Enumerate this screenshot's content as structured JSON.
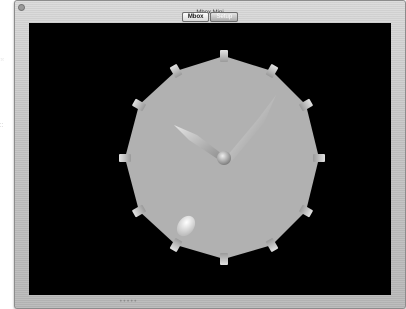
{
  "window": {
    "title": "Mbox Mini"
  },
  "tabs": [
    {
      "label": "Mbox",
      "active": true
    },
    {
      "label": "Setup",
      "active": false
    }
  ],
  "clock": {
    "hour_markers": 12,
    "colors": {
      "background": "#000000",
      "face": "#b1b1b1",
      "hands": "#c7c7c7"
    }
  },
  "pager": {
    "dots": "•••••"
  },
  "side_indicators": {
    "top": "⁙",
    "mid": "⁚⁚"
  }
}
